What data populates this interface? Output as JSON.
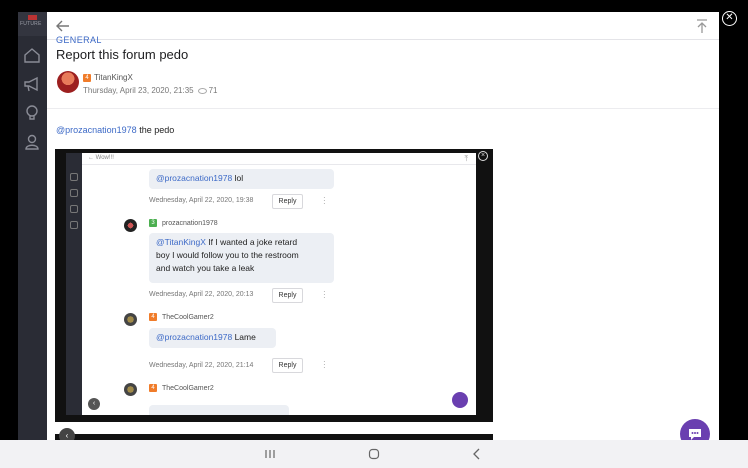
{
  "sidebar": {
    "logo_text": "FUTURE",
    "items": [
      {
        "icon": "home-icon"
      },
      {
        "icon": "megaphone-icon"
      },
      {
        "icon": "lightbulb-icon"
      },
      {
        "icon": "user-icon"
      }
    ]
  },
  "topbar": {
    "back_icon": "back-arrow-icon",
    "scroll_top_icon": "scroll-to-top-icon"
  },
  "post": {
    "category": "GENERAL",
    "title": "Report this forum pedo",
    "author_rank": "4",
    "author": "TitanKingX",
    "date": "Thursday, April 23, 2020, 21:35",
    "views": "71",
    "mention": "@prozacnation1978",
    "text": " the pedo"
  },
  "embedded": {
    "back_label": "← Wow!!!",
    "messages": [
      {
        "mention": "@prozacnation1978",
        "text": " lol",
        "date": "Wednesday, April 22, 2020, 19:38",
        "reply": "Reply"
      },
      {
        "rank": "3",
        "user": "prozacnation1978",
        "mention": "@TitanKingX",
        "text_line1": " If I wanted a joke retard",
        "text_line2": "boy I would follow you to the restroom",
        "text_line3": "and watch you take a leak",
        "date": "Wednesday, April 22, 2020, 20:13",
        "reply": "Reply"
      },
      {
        "rank": "4",
        "user": "TheCoolGamer2",
        "mention": "@prozacnation1978",
        "text": " Lame",
        "date": "Wednesday, April 22, 2020, 21:14",
        "reply": "Reply"
      },
      {
        "rank": "4",
        "user": "TheCoolGamer2"
      }
    ]
  },
  "colors": {
    "accent": "#3d6ac7",
    "rank_orange": "#f07c2a",
    "rank_green": "#4caf50",
    "chat_purple": "#6a3fb0"
  },
  "system_nav": {
    "recents": "recents-icon",
    "home": "home-circle-icon",
    "back": "back-chevron-icon"
  }
}
